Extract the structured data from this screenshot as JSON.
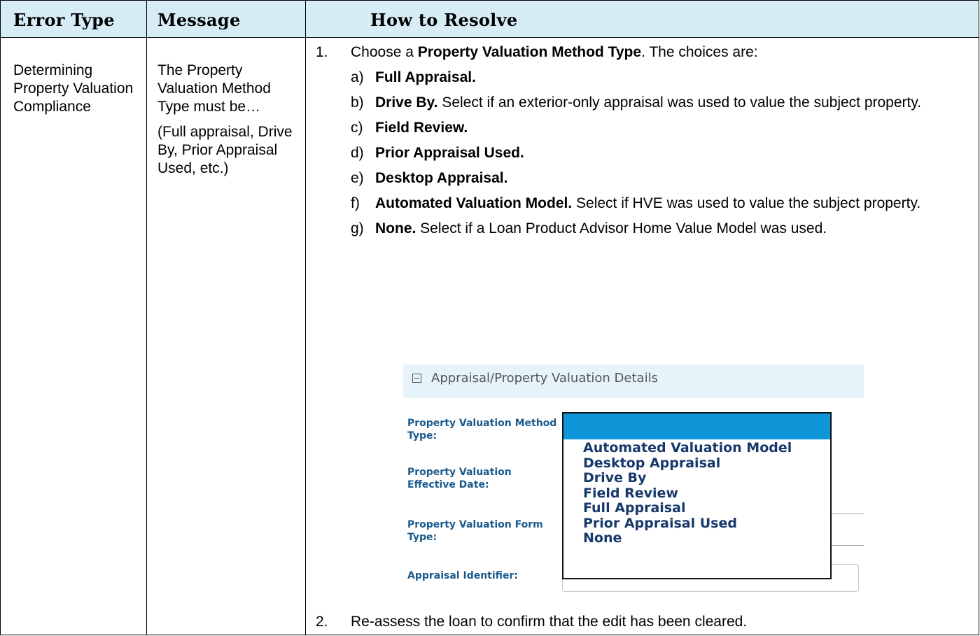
{
  "header": {
    "col1": "Error Type",
    "col2": "Message",
    "col3": "How to Resolve"
  },
  "row": {
    "error_type": "Determining Property Valuation Compliance",
    "message_p1": "The Property Valuation Method Type must be…",
    "message_p2": "(Full appraisal, Drive By, Prior Appraisal Used, etc.)",
    "step1": {
      "num": "1.",
      "pre": "Choose a ",
      "bold": "Property Valuation Method Type",
      "post": ". The choices are:"
    },
    "choices": [
      {
        "letter": "a)",
        "bold": "Full Appraisal.",
        "text": ""
      },
      {
        "letter": "b)",
        "bold": "Drive By.",
        "text": " Select if an exterior-only appraisal was used to value the subject property."
      },
      {
        "letter": "c)",
        "bold": "Field Review.",
        "text": ""
      },
      {
        "letter": "d)",
        "bold": "Prior Appraisal Used.",
        "text": ""
      },
      {
        "letter": "e)",
        "bold": "Desktop Appraisal.",
        "text": ""
      },
      {
        "letter": "f)",
        "bold": "Automated Valuation Model.",
        "text": " Select if HVE was used to value the subject property."
      },
      {
        "letter": "g)",
        "bold": "None.",
        "text": " Select if a Loan Product Advisor Home Value Model was used."
      }
    ],
    "step2": {
      "num": "2.",
      "text": "Re-assess the loan to confirm that the edit has been cleared."
    }
  },
  "screenshot": {
    "section_title": "Appraisal/Property Valuation Details",
    "fields": [
      "Property Valuation Method Type:",
      "Property Valuation Effective Date:",
      "Property Valuation Form Type:",
      "Appraisal Identifier:"
    ],
    "dropdown_options": [
      "Automated Valuation Model",
      "Desktop Appraisal",
      "Drive By",
      "Field Review",
      "Full Appraisal",
      "Prior Appraisal Used",
      "None"
    ],
    "colors": {
      "selected": "#0e96d8",
      "label": "#1b5a8c",
      "header_bg": "#e7f3fa"
    }
  }
}
